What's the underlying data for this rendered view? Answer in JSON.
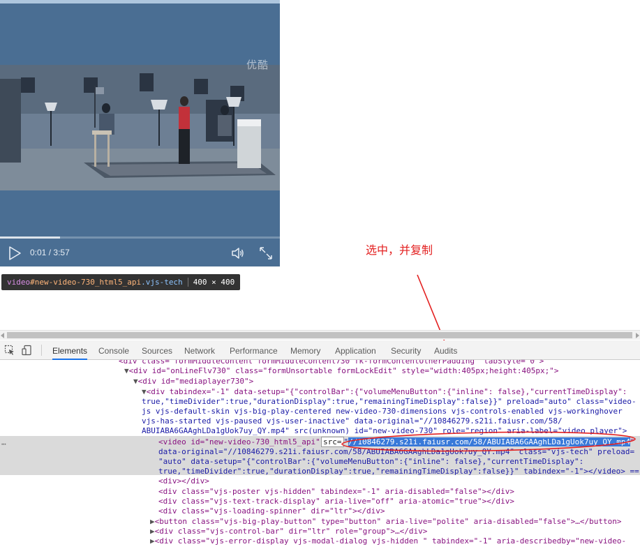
{
  "player": {
    "watermark": "优酷",
    "current_time": "0:01",
    "time_divider": "/",
    "duration": "3:57",
    "progress": 0.0042,
    "colors": {
      "overlay": "#4a6e93",
      "controls": "#e8eef5"
    }
  },
  "element_tooltip": {
    "tag": "video",
    "id": "#new-video-730_html5_api",
    "class": ".vjs-tech",
    "size": "400 × 400"
  },
  "annotation": {
    "text": "选中，并复制",
    "color": "#e32020"
  },
  "devtools": {
    "tabs": [
      "Elements",
      "Console",
      "Sources",
      "Network",
      "Performance",
      "Memory",
      "Application",
      "Security",
      "Audits"
    ],
    "active_tab": "Elements",
    "selected_src": "//10846279.s21i.faiusr.com/58/ABUIABA6GAAghLDa1gUok7uy_QY.mp4",
    "lines": [
      "<div class=\"formMiddleContent formMiddleContent730 fk-formContentOtherPadding\" tabStyle=\"0\">",
      "<div id=\"onLineFlv730\" class=\"formUnsortable formLockEdit\" style=\"width:405px;height:405px;\">",
      "<div id=\"mediaplayer730\">",
      "<div tabindex=\"-1\" data-setup=\"{\"controlBar\":{\"volumeMenuButton\":{\"inline\": false},\"currentTimeDisplay\":",
      "true,\"timeDivider\":true,\"durationDisplay\":true,\"remainingTimeDisplay\":false}}\" preload=\"auto\" class=\"video-",
      "js vjs-default-skin vjs-big-play-centered new-video-730-dimensions vjs-controls-enabled vjs-workinghover",
      "vjs-has-started vjs-paused vjs-user-inactive\" data-original=\"//10846279.s21i.faiusr.com/58/",
      "ABUIABA6GAAghLDa1gUok7uy_QY.mp4\" src(unknown) id=\"new-video-730\" role=\"region\" aria-label=\"video player\">",
      "<video id=\"new-video-730_html5_api\" src=\"//10846279.s21i.faiusr.com/58/ABUIABA6GAAghLDa1gUok7uy_QY.mp4\"",
      "data-original=\"//10846279.s21i.faiusr.com/58/ABUIABA6GAAghLDa1gUok7uy_QY.mp4\" class=\"vjs-tech\" preload=",
      "\"auto\" data-setup=\"{\"controlBar\":{\"volumeMenuButton\":{\"inline\": false},\"currentTimeDisplay\":",
      "true,\"timeDivider\":true,\"durationDisplay\":true,\"remainingTimeDisplay\":false}}\" tabindex=\"-1\"></video> ==",
      "<div></div>",
      "<div class=\"vjs-poster vjs-hidden\" tabindex=\"-1\" aria-disabled=\"false\"></div>",
      "<div class=\"vjs-text-track-display\" aria-live=\"off\" aria-atomic=\"true\"></div>",
      "<div class=\"vjs-loading-spinner\" dir=\"ltr\"></div>",
      "<button class=\"vjs-big-play-button\" type=\"button\" aria-live=\"polite\" aria-disabled=\"false\">…</button>",
      "<div class=\"vjs-control-bar\" dir=\"ltr\" role=\"group\">…</div>",
      "<div class=\"vjs-error-display vjs-modal-dialog vjs-hidden \" tabindex=\"-1\" aria-describedby=\"new-video-"
    ]
  }
}
